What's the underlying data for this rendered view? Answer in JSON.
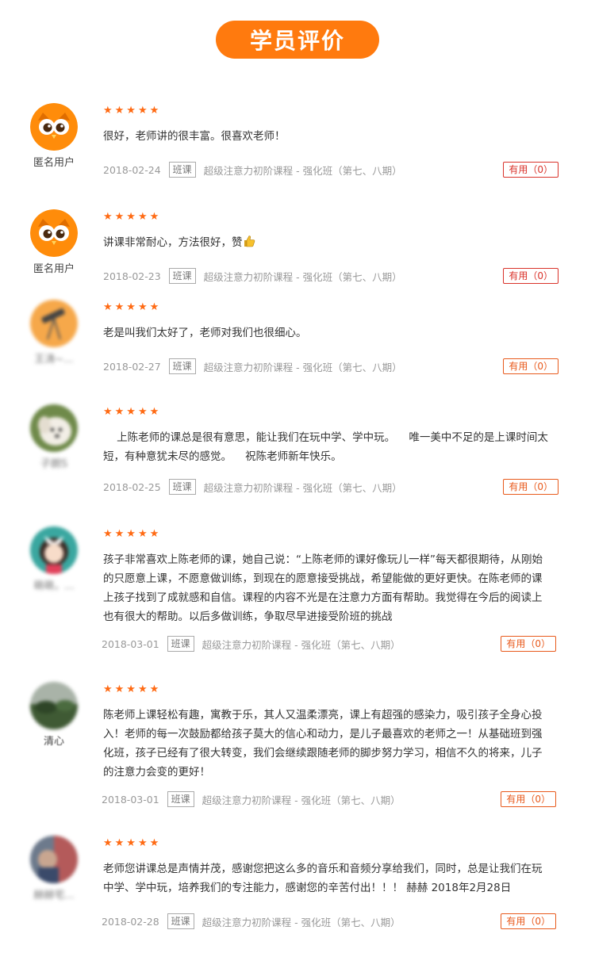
{
  "header": {
    "title": "学员评价"
  },
  "reviews": [
    {
      "avatar": "owl-avatar-icon",
      "username": "匿名用户",
      "stars": "★★★★★",
      "content": "很好，老师讲的很丰富。很喜欢老师！",
      "date": "2018-02-24",
      "tag": "班课",
      "course": "超级注意力初阶课程 - 强化班（第七、八期）",
      "helpful": "有用（0）"
    },
    {
      "avatar": "owl-avatar-icon",
      "username": "匿名用户",
      "stars": "★★★★★",
      "content": "讲课非常耐心，方法很好，赞",
      "emoji": "thumbs-up-icon",
      "date": "2018-02-23",
      "tag": "班课",
      "course": "超级注意力初阶课程 - 强化班（第七、八期）",
      "helpful": "有用（0）"
    },
    {
      "avatar": "telescope-avatar-icon",
      "username": "王涛~...",
      "stars": "★★★★★",
      "content": "老是叫我们太好了，老师对我们也很细心。",
      "date": "2018-02-27",
      "tag": "班课",
      "course": "超级注意力初阶课程 - 强化班（第七、八期）",
      "helpful": "有用（0）"
    },
    {
      "avatar": "dog-avatar-icon",
      "username": "子朗S",
      "stars": "★★★★★",
      "content": "    上陈老师的课总是很有意思，能让我们在玩中学、学中玩。    唯一美中不足的是上课时间太短，有种意犹未尽的感觉。    祝陈老师新年快乐。",
      "date": "2018-02-25",
      "tag": "班课",
      "course": "超级注意力初阶课程 - 强化班（第七、八期）",
      "helpful": "有用（0）"
    },
    {
      "avatar": "girl-avatar-icon",
      "username": "萌萌，...",
      "stars": "★★★★★",
      "content": "孩子非常喜欢上陈老师的课，她自己说：“上陈老师的课好像玩儿一样”每天都很期待，从刚始的只愿意上课，不愿意做训练，到现在的愿意接受挑战，希望能做的更好更快。在陈老师的课上孩子找到了成就感和自信。课程的内容不光是在注意力方面有帮助。我觉得在今后的阅读上也有很大的帮助。以后多做训练，争取尽早进接受阶班的挑战",
      "date": "2018-03-01",
      "tag": "班课",
      "course": "超级注意力初阶课程 - 强化班（第七、八期）",
      "helpful": "有用（0）"
    },
    {
      "avatar": "landscape-avatar-icon",
      "username": "清心",
      "stars": "★★★★★",
      "content": "陈老师上课轻松有趣，寓教于乐，其人又温柔漂亮，课上有超强的感染力，吸引孩子全身心投入！老师的每一次鼓励都给孩子莫大的信心和动力，是儿子最喜欢的老师之一！从基础班到强化班，孩子已经有了很大转变，我们会继续跟随老师的脚步努力学习，相信不久的将来，儿子的注意力会变的更好！",
      "date": "2018-03-01",
      "tag": "班课",
      "course": "超级注意力初阶课程 - 强化班（第七、八期）",
      "helpful": "有用（0）"
    },
    {
      "avatar": "photo-avatar-icon",
      "username": "赫赫宅...",
      "stars": "★★★★★",
      "content": "老师您讲课总是声情并茂，感谢您把这么多的音乐和音频分享给我们，同时，总是让我们在玩中学、学中玩，培养我们的专注能力，感谢您的辛苦付出！！！ 赫赫 2018年2月28日",
      "date": "2018-02-28",
      "tag": "班课",
      "course": "超级注意力初阶课程 - 强化班（第七、八期）",
      "helpful": "有用（0）"
    }
  ]
}
